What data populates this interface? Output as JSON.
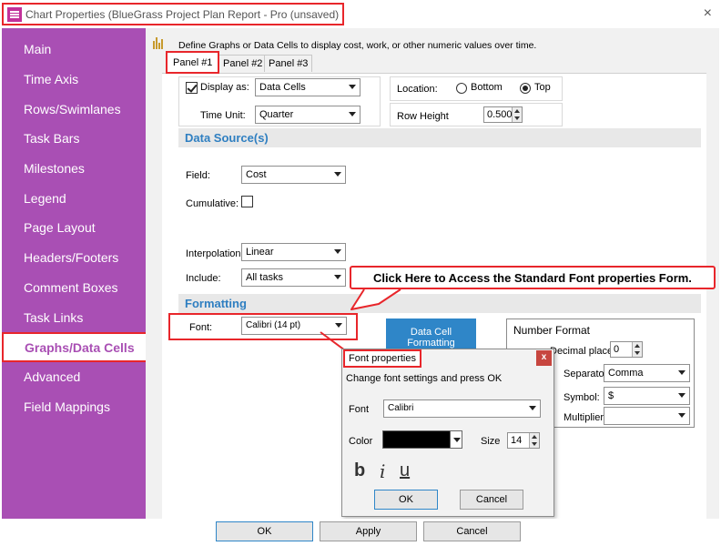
{
  "window": {
    "title": "Chart Properties (BlueGrass Project Plan Report - Pro (unsaved)",
    "close": "×"
  },
  "sidebar": {
    "items": [
      "Main",
      "Time Axis",
      "Rows/Swimlanes",
      "Task Bars",
      "Milestones",
      "Legend",
      "Page Layout",
      "Headers/Footers",
      "Comment Boxes",
      "Task Links",
      "Graphs/Data Cells",
      "Advanced",
      "Field Mappings"
    ],
    "selected": "Graphs/Data Cells"
  },
  "header": {
    "text": "Define Graphs or Data Cells to display cost, work, or other numeric values over time."
  },
  "tabs": [
    "Panel #1",
    "Panel #2",
    "Panel #3"
  ],
  "display": {
    "display_as_label": "Display as:",
    "display_as_value": "Data Cells",
    "time_unit_label": "Time Unit:",
    "time_unit_value": "Quarter",
    "location_label": "Location:",
    "location_bottom": "Bottom",
    "location_top": "Top",
    "row_height_label": "Row Height",
    "row_height_value": "0.500"
  },
  "data_source": {
    "title": "Data Source(s)",
    "field_label": "Field:",
    "field_value": "Cost",
    "cumulative_label": "Cumulative:",
    "interpolation_label": "Interpolation:",
    "interpolation_value": "Linear",
    "include_label": "Include:",
    "include_value": "All tasks"
  },
  "formatting": {
    "title": "Formatting",
    "font_label": "Font:",
    "font_value": "Calibri (14 pt)",
    "data_cell_button": "Data Cell Formatting"
  },
  "callout": "Click Here to Access the Standard Font properties Form.",
  "number_format": {
    "title": "Number Format",
    "decimal_label": "Decimal places:",
    "decimal_value": "0",
    "separator_label": "Separator:",
    "separator_value": "Comma",
    "symbol_label": "Symbol:",
    "symbol_value": "$",
    "multiplier_label": "Multiplier:",
    "multiplier_value": ""
  },
  "font_popup": {
    "title": "Font properties",
    "instruction": "Change font settings and press OK",
    "font_label": "Font",
    "font_value": "Calibri",
    "color_label": "Color",
    "color_value": "#000000",
    "size_label": "Size",
    "size_value": "14",
    "bold": "b",
    "italic": "i",
    "underline": "u",
    "ok": "OK",
    "cancel": "Cancel"
  },
  "footer": {
    "ok": "OK",
    "apply": "Apply",
    "cancel": "Cancel"
  },
  "colors": {
    "sidebar": "#a94fb4",
    "highlight": "#e8262b",
    "accent": "#2f86c8",
    "section_title": "#2f7fc1"
  }
}
